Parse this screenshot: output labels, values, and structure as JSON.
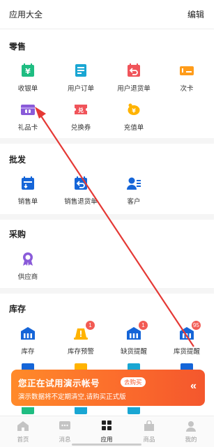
{
  "header": {
    "title": "应用大全",
    "edit": "编辑"
  },
  "sections": {
    "retail": {
      "title": "零售",
      "items": [
        {
          "label": "收银单",
          "icon": "cash-register-icon"
        },
        {
          "label": "用户订单",
          "icon": "user-order-icon"
        },
        {
          "label": "用户退货单",
          "icon": "user-return-icon"
        },
        {
          "label": "次卡",
          "icon": "card-icon"
        },
        {
          "label": "礼品卡",
          "icon": "gift-card-icon"
        },
        {
          "label": "兑换券",
          "icon": "voucher-icon"
        },
        {
          "label": "充值单",
          "icon": "recharge-icon"
        }
      ]
    },
    "wholesale": {
      "title": "批发",
      "items": [
        {
          "label": "销售单",
          "icon": "sales-order-icon"
        },
        {
          "label": "销售退货单",
          "icon": "sales-return-icon"
        },
        {
          "label": "客户",
          "icon": "customer-icon"
        }
      ]
    },
    "purchase": {
      "title": "采购",
      "items": [
        {
          "label": "供应商",
          "icon": "supplier-icon"
        }
      ]
    },
    "inventory": {
      "title": "库存",
      "items": [
        {
          "label": "库存",
          "icon": "warehouse-icon",
          "badge": ""
        },
        {
          "label": "库存预警",
          "icon": "warning-icon",
          "badge": "1"
        },
        {
          "label": "缺货提醒",
          "icon": "shortage-icon",
          "badge": "1"
        },
        {
          "label": "库货提醒",
          "icon": "stock-reminder-icon",
          "badge": "95"
        }
      ]
    }
  },
  "banner": {
    "title": "您正在试用演示帐号",
    "button": "去购买",
    "subtitle": "演示数据将不定期清空,请购买正式版",
    "arrow": "«"
  },
  "tabbar": [
    {
      "label": "首页",
      "icon": "home-icon",
      "active": false
    },
    {
      "label": "消息",
      "icon": "message-icon",
      "active": false
    },
    {
      "label": "应用",
      "icon": "apps-icon",
      "active": true
    },
    {
      "label": "商品",
      "icon": "goods-icon",
      "active": false
    },
    {
      "label": "我的",
      "icon": "profile-icon",
      "active": false
    }
  ],
  "colors": {
    "green": "#1fbd82",
    "cyan": "#19a6d3",
    "red": "#f0545a",
    "orange": "#ff9c1a",
    "purple": "#8a5bd9",
    "yellow": "#ffb300",
    "blue": "#1565d8",
    "banner": "#fb6a2c",
    "annotation": "#e53935"
  }
}
